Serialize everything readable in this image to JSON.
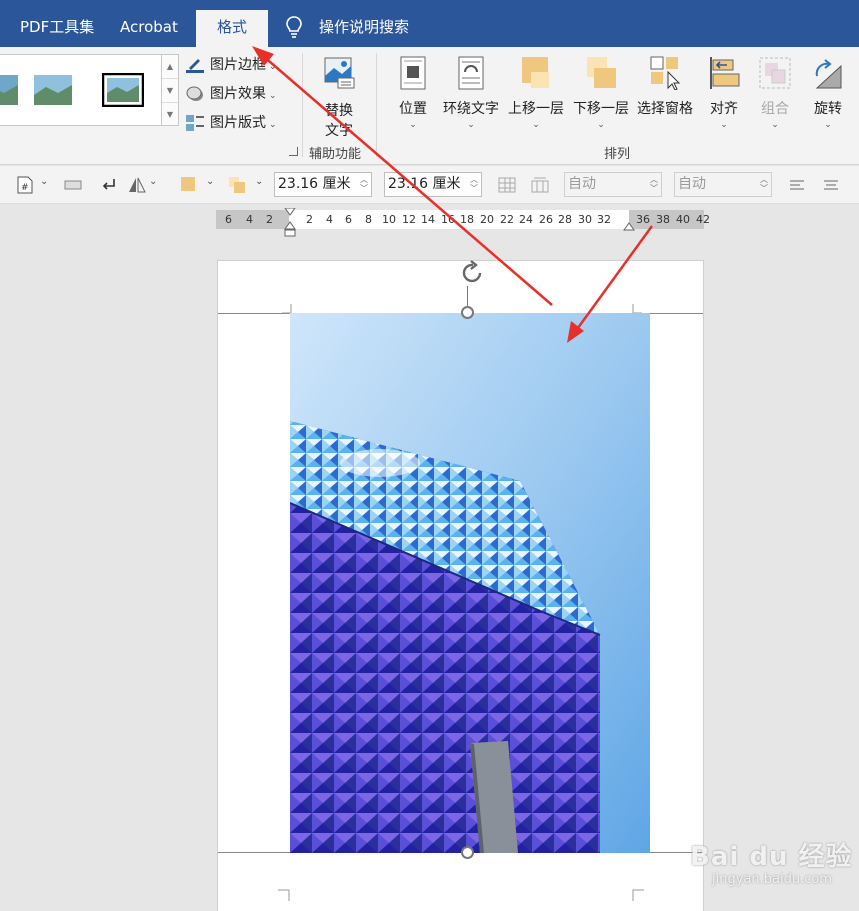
{
  "tabs": [
    {
      "label": "PDF工具集",
      "active": false
    },
    {
      "label": "Acrobat",
      "active": false
    },
    {
      "label": "格式",
      "active": true
    }
  ],
  "tell_me": {
    "label": "操作说明搜索",
    "icon": "lightbulb-icon"
  },
  "picture_styles": {
    "menu": [
      {
        "label": "图片边框",
        "icon": "pen-border-icon"
      },
      {
        "label": "图片效果",
        "icon": "effects-icon"
      },
      {
        "label": "图片版式",
        "icon": "layout-icon"
      }
    ]
  },
  "accessibility_group": {
    "label": "辅助功能",
    "alt_text_line1": "替换",
    "alt_text_line2": "文字"
  },
  "arrange_group": {
    "label": "排列",
    "buttons": [
      {
        "label": "位置",
        "enabled": true
      },
      {
        "label": "环绕文字",
        "enabled": true
      },
      {
        "label": "上移一层",
        "enabled": true
      },
      {
        "label": "下移一层",
        "enabled": true
      },
      {
        "label": "选择窗格",
        "enabled": true
      },
      {
        "label": "对齐",
        "enabled": true
      },
      {
        "label": "组合",
        "enabled": false
      },
      {
        "label": "旋转",
        "enabled": true
      }
    ]
  },
  "size_fields": {
    "height": "23.16 厘米",
    "width": "23.16 厘米",
    "auto1": "自动",
    "auto2": "自动"
  },
  "ruler": {
    "labels": [
      "6",
      "4",
      "2",
      "2",
      "4",
      "6",
      "8",
      "10",
      "12",
      "14",
      "16",
      "18",
      "20",
      "22",
      "24",
      "26",
      "28",
      "30",
      "32",
      "36",
      "38",
      "40",
      "42"
    ]
  },
  "watermark": {
    "line1": "Bai du 经验",
    "line2": "jingyan.baidu.com"
  },
  "colors": {
    "title_bar": "#2b579a",
    "arrow": "#e8302a",
    "ribbon": "#f3f3f3"
  }
}
